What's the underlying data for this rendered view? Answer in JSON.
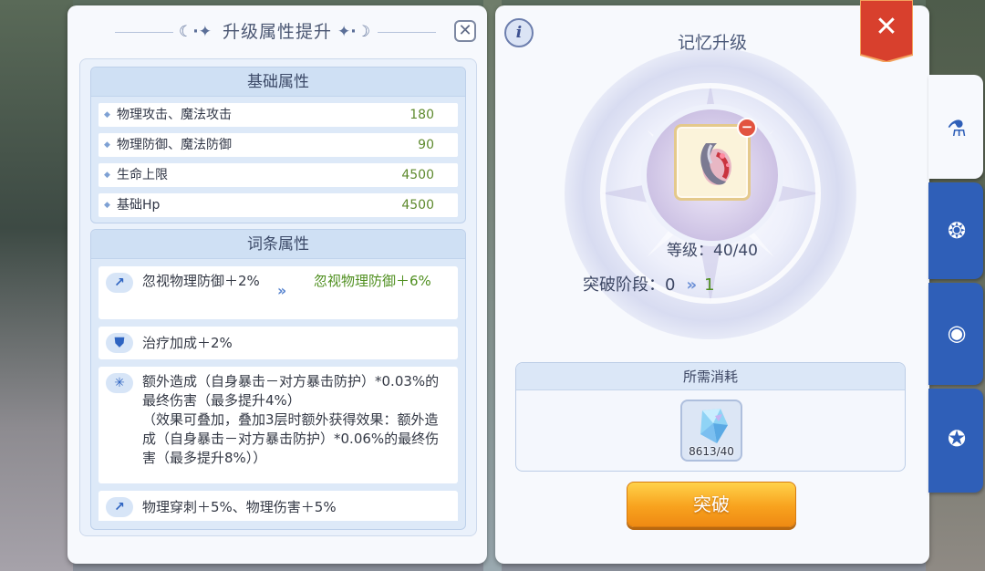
{
  "upgrade_panel": {
    "title": "升级属性提升",
    "base_section": {
      "title": "基础属性",
      "rows": [
        {
          "name": "物理攻击、魔法攻击",
          "value": "180"
        },
        {
          "name": "物理防御、魔法防御",
          "value": "90"
        },
        {
          "name": "生命上限",
          "value": "4500"
        },
        {
          "name": "基础Hp",
          "value": "4500"
        }
      ]
    },
    "affix_section": {
      "title": "词条属性",
      "items": [
        {
          "icon": "sword-icon",
          "text": "忽视物理防御＋2%",
          "new_text": "忽视物理防御＋6%"
        },
        {
          "icon": "shield-icon",
          "text": "治疗加成＋2%"
        },
        {
          "icon": "snowflake-icon",
          "text": "额外造成（自身暴击－对方暴击防护）*0.03%的最终伤害（最多提升4%）\n（效果可叠加，叠加3层时额外获得效果：额外造成（自身暴击－对方暴击防护）*0.06%的最终伤害（最多提升8%））"
        },
        {
          "icon": "sword-icon",
          "text": "物理穿刺＋5%、物理伤害＋5%"
        }
      ]
    }
  },
  "memory_panel": {
    "title": "记忆升级",
    "level_label": "等级：40/40",
    "stage_label": "突破阶段：",
    "stage_current": "0",
    "stage_next": "1",
    "cost_title": "所需消耗",
    "cost_item": {
      "icon": "crystal-icon",
      "count": "8613/40"
    },
    "break_button": "突破"
  },
  "tabs": [
    {
      "name": "tab-memory",
      "icon": "potion-icon",
      "active": true
    },
    {
      "name": "tab-pet",
      "icon": "spin-icon",
      "active": false
    },
    {
      "name": "tab-orbit",
      "icon": "orbit-icon",
      "active": false
    },
    {
      "name": "tab-star",
      "icon": "star-bag-icon",
      "active": false
    }
  ],
  "colors": {
    "accent": "#2f5fb8",
    "green_value": "#5e8a2e",
    "button_orange": "#f8a21e",
    "close_red": "#d8402d"
  }
}
